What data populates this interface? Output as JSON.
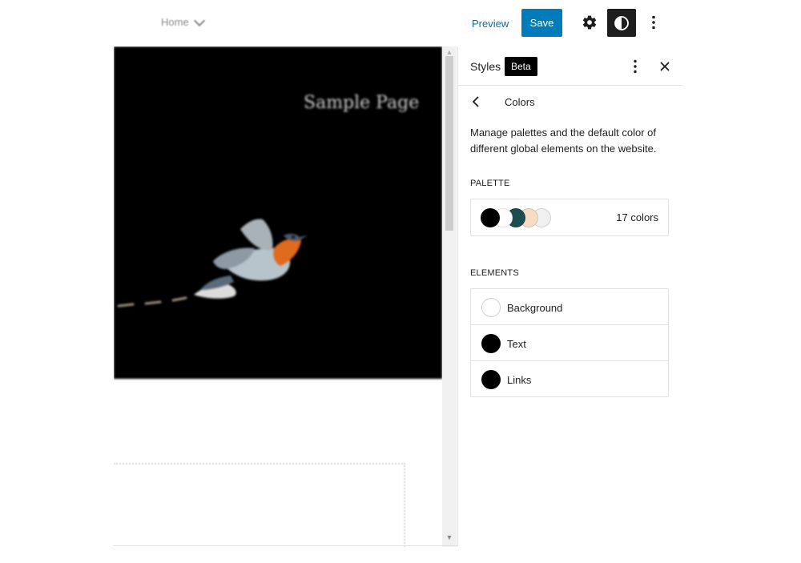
{
  "topbar": {
    "document_title": "Home",
    "preview_label": "Preview",
    "save_label": "Save",
    "settings_icon": "gear-icon",
    "styles_icon": "half-circle-contrast-icon",
    "options_icon": "vertical-ellipsis-icon",
    "accent_color": "#007cba"
  },
  "canvas": {
    "hero_text": "Sample Page",
    "hero_background": "#000000"
  },
  "sidebar": {
    "title": "Styles",
    "badge": "Beta",
    "nav_title": "Colors",
    "description": "Manage palettes and the default color of different global elements on the website.",
    "palette": {
      "label": "PALETTE",
      "count_text": "17 colors",
      "swatches": [
        "#000000",
        "#ffffff",
        "#1e4d4f",
        "#f6dcc3",
        "#f0f0f0"
      ]
    },
    "elements": {
      "label": "ELEMENTS",
      "items": [
        {
          "label": "Background",
          "color": "#ffffff"
        },
        {
          "label": "Text",
          "color": "#000000"
        },
        {
          "label": "Links",
          "color": "#000000"
        }
      ]
    }
  }
}
